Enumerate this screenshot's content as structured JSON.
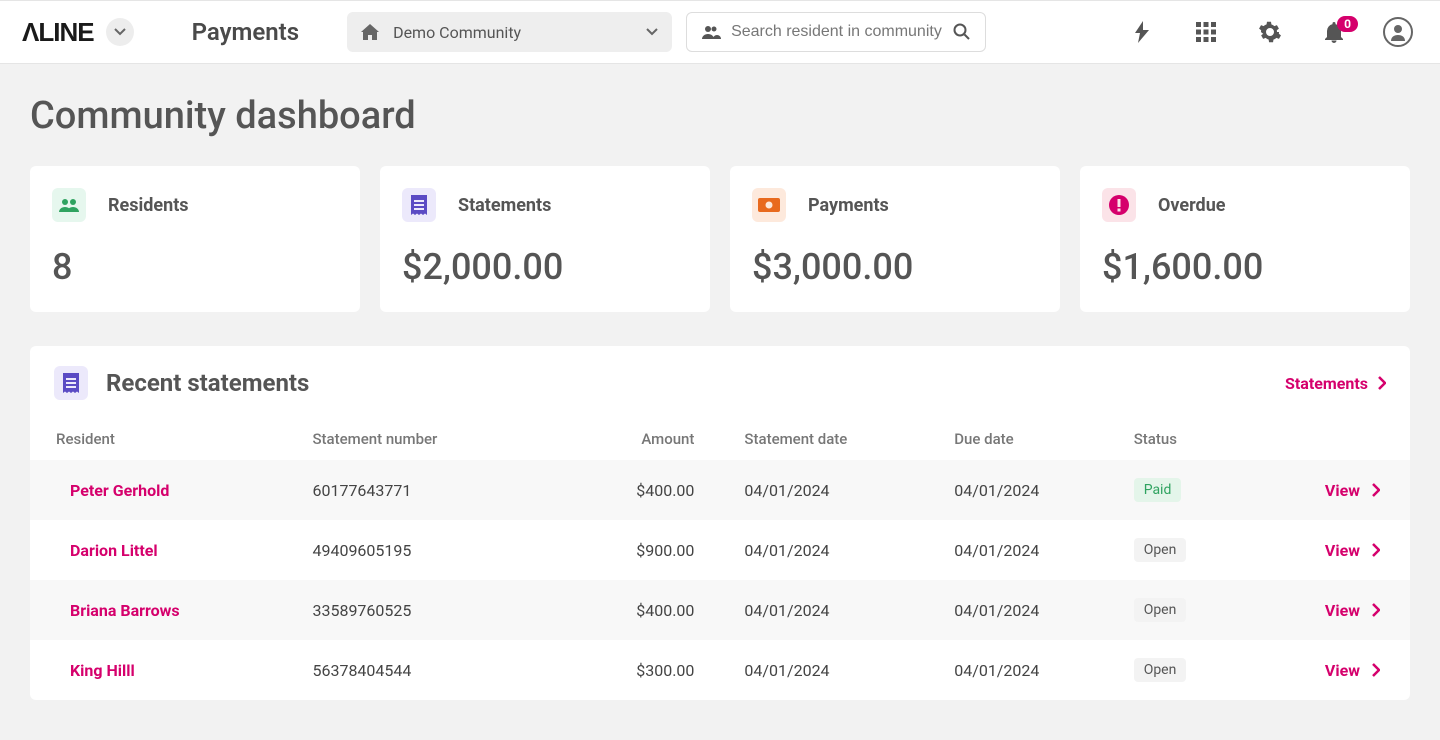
{
  "header": {
    "brand": "ΛLINE",
    "nav": "Payments",
    "community": "Demo Community",
    "search_placeholder": "Search resident in community",
    "notification_count": "0"
  },
  "page": {
    "title": "Community dashboard"
  },
  "cards": [
    {
      "label": "Residents",
      "value": "8",
      "icon": "residents"
    },
    {
      "label": "Statements",
      "value": "$2,000.00",
      "icon": "statements"
    },
    {
      "label": "Payments",
      "value": "$3,000.00",
      "icon": "payments"
    },
    {
      "label": "Overdue",
      "value": "$1,600.00",
      "icon": "overdue"
    }
  ],
  "statements": {
    "title": "Recent statements",
    "link_label": "Statements",
    "view_label": "View",
    "columns": [
      "Resident",
      "Statement number",
      "Amount",
      "Statement date",
      "Due date",
      "Status",
      ""
    ],
    "rows": [
      {
        "resident": "Peter Gerhold",
        "number": "60177643771",
        "amount": "$400.00",
        "stmt_date": "04/01/2024",
        "due_date": "04/01/2024",
        "status": "Paid",
        "status_class": "status-paid"
      },
      {
        "resident": "Darion Littel",
        "number": "49409605195",
        "amount": "$900.00",
        "stmt_date": "04/01/2024",
        "due_date": "04/01/2024",
        "status": "Open",
        "status_class": ""
      },
      {
        "resident": "Briana Barrows",
        "number": "33589760525",
        "amount": "$400.00",
        "stmt_date": "04/01/2024",
        "due_date": "04/01/2024",
        "status": "Open",
        "status_class": ""
      },
      {
        "resident": "King Hilll",
        "number": "56378404544",
        "amount": "$300.00",
        "stmt_date": "04/01/2024",
        "due_date": "04/01/2024",
        "status": "Open",
        "status_class": ""
      }
    ]
  }
}
